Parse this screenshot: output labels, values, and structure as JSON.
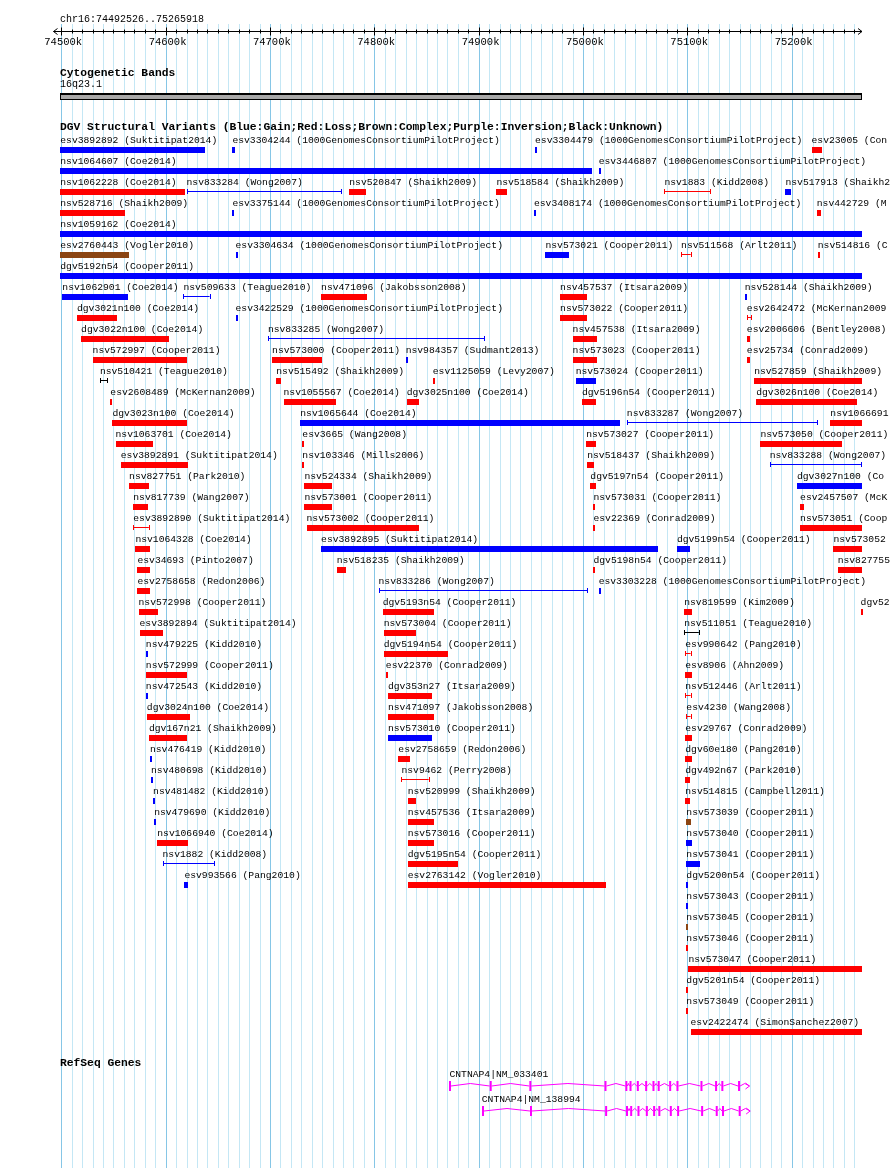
{
  "ruler": {
    "title": "chr16:74492526..75265918",
    "ticks": [
      "74500k",
      "74600k",
      "74700k",
      "74800k",
      "74900k",
      "75000k",
      "75100k",
      "75200k"
    ]
  },
  "cytogenetic_bands": {
    "title": "Cytogenetic Bands",
    "bands": [
      {
        "label": "16q23.1"
      }
    ]
  },
  "dgv": {
    "title": "DGV Structural Variants (Blue:Gain;Red:Loss;Brown:Complex;Purple:Inversion;Black:Unknown)",
    "rows": [
      {
        "features": [
          {
            "label": "esv3892892 (Suktitipat2014)",
            "kind": "bar",
            "color": "#0000ff"
          },
          {
            "label": "esv3304244 (1000GenomesConsortiumPilotProject)",
            "kind": "bar",
            "color": "#0000ff"
          },
          {
            "label": "esv3304479 (1000GenomesConsortiumPilotProject)",
            "kind": "bar",
            "color": "#0000ff"
          },
          {
            "label": "esv23005 (Con",
            "kind": "bar",
            "color": "#ff0000"
          }
        ]
      },
      {
        "features": [
          {
            "label": "nsv1064607 (Coe2014)",
            "kind": "bar",
            "color": "#0000ff"
          },
          {
            "label": "esv3446807 (1000GenomesConsortiumPilotProject)",
            "kind": "bar",
            "color": "#0000ff"
          }
        ]
      },
      {
        "features": [
          {
            "label": "nsv1062228 (Coe2014)",
            "kind": "bar",
            "color": "#ff0000"
          },
          {
            "label": "nsv833284 (Wong2007)",
            "kind": "span",
            "color": "#0000ff"
          },
          {
            "label": "nsv520847 (Shaikh2009)",
            "kind": "bar",
            "color": "#ff0000"
          },
          {
            "label": "nsv518584 (Shaikh2009)",
            "kind": "bar",
            "color": "#ff0000"
          },
          {
            "label": "nsv1883 (Kidd2008)",
            "kind": "span",
            "color": "#ff0000"
          },
          {
            "label": "nsv517913 (Shaikh2",
            "kind": "bar",
            "color": "#0000ff"
          }
        ]
      },
      {
        "features": [
          {
            "label": "nsv528716 (Shaikh2009)",
            "kind": "bar",
            "color": "#ff0000"
          },
          {
            "label": "esv3375144 (1000GenomesConsortiumPilotProject)",
            "kind": "bar",
            "color": "#0000ff"
          },
          {
            "label": "esv3408174 (1000GenomesConsortiumPilotProject)",
            "kind": "bar",
            "color": "#0000ff"
          },
          {
            "label": "nsv442729 (M",
            "kind": "bar",
            "color": "#ff0000"
          }
        ]
      },
      {
        "features": [
          {
            "label": "nsv1059162 (Coe2014)",
            "kind": "bar",
            "color": "#0000ff"
          }
        ]
      },
      {
        "features": [
          {
            "label": "esv2760443 (Vogler2010)",
            "kind": "bar",
            "color": "#8b4513"
          },
          {
            "label": "esv3304634 (1000GenomesConsortiumPilotProject)",
            "kind": "bar",
            "color": "#0000ff"
          },
          {
            "label": "nsv573021 (Cooper2011)",
            "kind": "bar",
            "color": "#0000ff"
          },
          {
            "label": "nsv511568 (Arlt2011)",
            "kind": "span",
            "color": "#ff0000"
          },
          {
            "label": "nsv514816 (C",
            "kind": "bar",
            "color": "#ff0000"
          }
        ]
      },
      {
        "features": [
          {
            "label": "dgv5192n54 (Cooper2011)",
            "kind": "bar",
            "color": "#0000ff"
          }
        ]
      },
      {
        "features": [
          {
            "label": "nsv1062901 (Coe2014)",
            "kind": "bar",
            "color": "#0000ff"
          },
          {
            "label": "nsv509633 (Teague2010)",
            "kind": "span",
            "color": "#0000ff"
          },
          {
            "label": "nsv471096 (Jakobsson2008)",
            "kind": "bar",
            "color": "#ff0000"
          },
          {
            "label": "nsv457537 (Itsara2009)",
            "kind": "bar",
            "color": "#ff0000"
          },
          {
            "label": "nsv528144 (Shaikh2009)",
            "kind": "bar",
            "color": "#0000ff"
          }
        ]
      },
      {
        "features": [
          {
            "label": "dgv3021n100 (Coe2014)",
            "kind": "bar",
            "color": "#ff0000"
          },
          {
            "label": "esv3422529 (1000GenomesConsortiumPilotProject)",
            "kind": "bar",
            "color": "#0000ff"
          },
          {
            "label": "nsv573022 (Cooper2011)",
            "kind": "bar",
            "color": "#ff0000"
          },
          {
            "label": "esv2642472 (McKernan2009",
            "kind": "span",
            "color": "#ff0000"
          }
        ]
      },
      {
        "features": [
          {
            "label": "dgv3022n100 (Coe2014)",
            "kind": "bar",
            "color": "#ff0000"
          },
          {
            "label": "nsv833285 (Wong2007)",
            "kind": "span",
            "color": "#0000ff"
          },
          {
            "label": "nsv457538 (Itsara2009)",
            "kind": "bar",
            "color": "#ff0000"
          },
          {
            "label": "esv2006606 (Bentley2008)",
            "kind": "bar",
            "color": "#ff0000"
          }
        ]
      },
      {
        "features": [
          {
            "label": "nsv572997 (Cooper2011)",
            "kind": "bar",
            "color": "#ff0000"
          },
          {
            "label": "nsv573000 (Cooper2011)",
            "kind": "bar",
            "color": "#ff0000"
          },
          {
            "label": "nsv984357 (Sudmant2013)",
            "kind": "bar",
            "color": "#0000ff"
          },
          {
            "label": "nsv573023 (Cooper2011)",
            "kind": "bar",
            "color": "#ff0000"
          },
          {
            "label": "esv25734 (Conrad2009)",
            "kind": "bar",
            "color": "#ff0000"
          }
        ]
      },
      {
        "features": [
          {
            "label": "nsv510421 (Teague2010)",
            "kind": "span",
            "color": "#000000"
          },
          {
            "label": "nsv515492 (Shaikh2009)",
            "kind": "bar",
            "color": "#ff0000"
          },
          {
            "label": "esv1125059 (Levy2007)",
            "kind": "bar",
            "color": "#ff0000"
          },
          {
            "label": "nsv573024 (Cooper2011)",
            "kind": "bar",
            "color": "#0000ff"
          },
          {
            "label": "nsv527859 (Shaikh2009)",
            "kind": "bar",
            "color": "#ff0000"
          }
        ]
      },
      {
        "features": [
          {
            "label": "esv2608489 (McKernan2009)",
            "kind": "bar",
            "color": "#ff0000"
          },
          {
            "label": "nsv1055567 (Coe2014)",
            "kind": "bar",
            "color": "#ff0000"
          },
          {
            "label": "dgv3025n100 (Coe2014)",
            "kind": "bar",
            "color": "#ff0000"
          },
          {
            "label": "dgv5196n54 (Cooper2011)",
            "kind": "bar",
            "color": "#ff0000"
          },
          {
            "label": "dgv3026n100 (Coe2014)",
            "kind": "bar",
            "color": "#ff0000"
          }
        ]
      },
      {
        "features": [
          {
            "label": "dgv3023n100 (Coe2014)",
            "kind": "bar",
            "color": "#ff0000"
          },
          {
            "label": "nsv1065644 (Coe2014)",
            "kind": "bar",
            "color": "#0000ff"
          },
          {
            "label": "nsv833287 (Wong2007)",
            "kind": "span",
            "color": "#0000ff"
          },
          {
            "label": "nsv1066691",
            "kind": "bar",
            "color": "#ff0000"
          }
        ]
      },
      {
        "features": [
          {
            "label": "nsv1063701 (Coe2014)",
            "kind": "bar",
            "color": "#ff0000"
          },
          {
            "label": "esv3665 (Wang2008)",
            "kind": "bar",
            "color": "#ff0000"
          },
          {
            "label": "nsv573027 (Cooper2011)",
            "kind": "bar",
            "color": "#ff0000"
          },
          {
            "label": "nsv573050 (Cooper2011)",
            "kind": "bar",
            "color": "#ff0000"
          }
        ]
      },
      {
        "features": [
          {
            "label": "esv3892891 (Suktitipat2014)",
            "kind": "bar",
            "color": "#ff0000"
          },
          {
            "label": "nsv103346 (Mills2006)",
            "kind": "bar",
            "color": "#ff0000"
          },
          {
            "label": "nsv518437 (Shaikh2009)",
            "kind": "bar",
            "color": "#ff0000"
          },
          {
            "label": "nsv833288 (Wong2007)",
            "kind": "span",
            "color": "#0000ff"
          }
        ]
      },
      {
        "features": [
          {
            "label": "nsv827751 (Park2010)",
            "kind": "bar",
            "color": "#ff0000"
          },
          {
            "label": "nsv524334 (Shaikh2009)",
            "kind": "bar",
            "color": "#ff0000"
          },
          {
            "label": "dgv5197n54 (Cooper2011)",
            "kind": "bar",
            "color": "#ff0000"
          },
          {
            "label": "dgv3027n100 (Co",
            "kind": "bar",
            "color": "#0000ff"
          }
        ]
      },
      {
        "features": [
          {
            "label": "nsv817739 (Wang2007)",
            "kind": "bar",
            "color": "#ff0000"
          },
          {
            "label": "nsv573001 (Cooper2011)",
            "kind": "bar",
            "color": "#ff0000"
          },
          {
            "label": "nsv573031 (Cooper2011)",
            "kind": "bar",
            "color": "#ff0000"
          },
          {
            "label": "esv2457507 (McK",
            "kind": "bar",
            "color": "#ff0000"
          }
        ]
      },
      {
        "features": [
          {
            "label": "esv3892890 (Suktitipat2014)",
            "kind": "span",
            "color": "#ff0000"
          },
          {
            "label": "nsv573002 (Cooper2011)",
            "kind": "bar",
            "color": "#ff0000"
          },
          {
            "label": "esv22369 (Conrad2009)",
            "kind": "bar",
            "color": "#ff0000"
          },
          {
            "label": "nsv573051 (Coop",
            "kind": "bar",
            "color": "#ff0000"
          }
        ]
      },
      {
        "features": [
          {
            "label": "nsv1064328 (Coe2014)",
            "kind": "bar",
            "color": "#ff0000"
          },
          {
            "label": "esv3892895 (Suktitipat2014)",
            "kind": "bar",
            "color": "#0000ff"
          },
          {
            "label": "dgv5199n54 (Cooper2011)",
            "kind": "bar",
            "color": "#0000ff"
          },
          {
            "label": "nsv573052",
            "kind": "bar",
            "color": "#ff0000"
          }
        ]
      },
      {
        "features": [
          {
            "label": "esv34693 (Pinto2007)",
            "kind": "bar",
            "color": "#ff0000"
          },
          {
            "label": "nsv518235 (Shaikh2009)",
            "kind": "bar",
            "color": "#ff0000"
          },
          {
            "label": "dgv5198n54 (Cooper2011)",
            "kind": "bar",
            "color": "#ff0000"
          },
          {
            "label": "nsv827755",
            "kind": "bar",
            "color": "#ff0000"
          }
        ]
      },
      {
        "features": [
          {
            "label": "esv2758658 (Redon2006)",
            "kind": "bar",
            "color": "#ff0000"
          },
          {
            "label": "nsv833286 (Wong2007)",
            "kind": "span",
            "color": "#0000ff"
          },
          {
            "label": "esv3303228 (1000GenomesConsortiumPilotProject)",
            "kind": "bar",
            "color": "#0000ff"
          }
        ]
      },
      {
        "features": [
          {
            "label": "nsv572998 (Cooper2011)",
            "kind": "bar",
            "color": "#ff0000"
          },
          {
            "label": "dgv5193n54 (Cooper2011)",
            "kind": "bar",
            "color": "#ff0000"
          },
          {
            "label": "nsv819599 (Kim2009)",
            "kind": "bar",
            "color": "#ff0000"
          },
          {
            "label": "dgv52",
            "kind": "bar",
            "color": "#ff0000"
          }
        ]
      },
      {
        "features": [
          {
            "label": "esv3892894 (Suktitipat2014)",
            "kind": "bar",
            "color": "#ff0000"
          },
          {
            "label": "nsv573004 (Cooper2011)",
            "kind": "bar",
            "color": "#ff0000"
          },
          {
            "label": "nsv511051 (Teague2010)",
            "kind": "span",
            "color": "#000000"
          }
        ]
      },
      {
        "features": [
          {
            "label": "nsv479225 (Kidd2010)",
            "kind": "bar",
            "color": "#0000ff"
          },
          {
            "label": "dgv5194n54 (Cooper2011)",
            "kind": "bar",
            "color": "#ff0000"
          },
          {
            "label": "esv990642 (Pang2010)",
            "kind": "span",
            "color": "#ff0000"
          }
        ]
      },
      {
        "features": [
          {
            "label": "nsv572999 (Cooper2011)",
            "kind": "bar",
            "color": "#ff0000"
          },
          {
            "label": "esv22370 (Conrad2009)",
            "kind": "bar",
            "color": "#ff0000"
          },
          {
            "label": "esv8906 (Ahn2009)",
            "kind": "bar",
            "color": "#ff0000"
          }
        ]
      },
      {
        "features": [
          {
            "label": "nsv472543 (Kidd2010)",
            "kind": "bar",
            "color": "#0000ff"
          },
          {
            "label": "dgv353n27 (Itsara2009)",
            "kind": "bar",
            "color": "#ff0000"
          },
          {
            "label": "nsv512446 (Arlt2011)",
            "kind": "span",
            "color": "#ff0000"
          }
        ]
      },
      {
        "features": [
          {
            "label": "dgv3024n100 (Coe2014)",
            "kind": "bar",
            "color": "#ff0000"
          },
          {
            "label": "nsv471097 (Jakobsson2008)",
            "kind": "bar",
            "color": "#ff0000"
          },
          {
            "label": "esv4230 (Wang2008)",
            "kind": "span",
            "color": "#ff0000"
          }
        ]
      },
      {
        "features": [
          {
            "label": "dgv167n21 (Shaikh2009)",
            "kind": "bar",
            "color": "#ff0000"
          },
          {
            "label": "nsv573010 (Cooper2011)",
            "kind": "bar",
            "color": "#0000ff"
          },
          {
            "label": "esv29767 (Conrad2009)",
            "kind": "bar",
            "color": "#ff0000"
          }
        ]
      },
      {
        "features": [
          {
            "label": "nsv476419 (Kidd2010)",
            "kind": "bar",
            "color": "#0000ff"
          },
          {
            "label": "esv2758659 (Redon2006)",
            "kind": "bar",
            "color": "#ff0000"
          },
          {
            "label": "dgv60e180 (Pang2010)",
            "kind": "bar",
            "color": "#ff0000"
          }
        ]
      },
      {
        "features": [
          {
            "label": "nsv480698 (Kidd2010)",
            "kind": "bar",
            "color": "#0000ff"
          },
          {
            "label": "nsv9462 (Perry2008)",
            "kind": "span",
            "color": "#ff0000"
          },
          {
            "label": "dgv492n67 (Park2010)",
            "kind": "bar",
            "color": "#ff0000"
          }
        ]
      },
      {
        "features": [
          {
            "label": "nsv481482 (Kidd2010)",
            "kind": "bar",
            "color": "#0000ff"
          },
          {
            "label": "nsv520999 (Shaikh2009)",
            "kind": "bar",
            "color": "#ff0000"
          },
          {
            "label": "nsv514815 (Campbell2011)",
            "kind": "bar",
            "color": "#ff0000"
          }
        ]
      },
      {
        "features": [
          {
            "label": "nsv479690 (Kidd2010)",
            "kind": "bar",
            "color": "#0000ff"
          },
          {
            "label": "nsv457536 (Itsara2009)",
            "kind": "bar",
            "color": "#ff0000"
          },
          {
            "label": "nsv573039 (Cooper2011)",
            "kind": "bar",
            "color": "#8b4513"
          }
        ]
      },
      {
        "features": [
          {
            "label": "nsv1066940 (Coe2014)",
            "kind": "bar",
            "color": "#ff0000"
          },
          {
            "label": "nsv573016 (Cooper2011)",
            "kind": "bar",
            "color": "#ff0000"
          },
          {
            "label": "nsv573040 (Cooper2011)",
            "kind": "bar",
            "color": "#0000ff"
          }
        ]
      },
      {
        "features": [
          {
            "label": "nsv1882 (Kidd2008)",
            "kind": "span",
            "color": "#0000ff"
          },
          {
            "label": "dgv5195n54 (Cooper2011)",
            "kind": "bar",
            "color": "#ff0000"
          },
          {
            "label": "nsv573041 (Cooper2011)",
            "kind": "bar",
            "color": "#0000ff"
          }
        ]
      },
      {
        "features": [
          {
            "label": "esv993566 (Pang2010)",
            "kind": "bar",
            "color": "#0000ff"
          },
          {
            "label": "esv2763142 (Vogler2010)",
            "kind": "bar",
            "color": "#ff0000"
          },
          {
            "label": "dgv5200n54 (Cooper2011)",
            "kind": "bar",
            "color": "#0000ff"
          }
        ]
      },
      {
        "features": [
          {
            "label": "nsv573043 (Cooper2011)",
            "kind": "bar",
            "color": "#0000ff"
          }
        ]
      },
      {
        "features": [
          {
            "label": "nsv573045 (Cooper2011)",
            "kind": "bar",
            "color": "#8b4513"
          }
        ]
      },
      {
        "features": [
          {
            "label": "nsv573046 (Cooper2011)",
            "kind": "bar",
            "color": "#ff0000"
          }
        ]
      },
      {
        "features": [
          {
            "label": "nsv573047 (Cooper2011)",
            "kind": "bar",
            "color": "#ff0000"
          }
        ]
      },
      {
        "features": [
          {
            "label": "dgv5201n54 (Cooper2011)",
            "kind": "bar",
            "color": "#ff0000"
          }
        ]
      },
      {
        "features": [
          {
            "label": "nsv573049 (Cooper2011)",
            "kind": "bar",
            "color": "#ff0000"
          }
        ]
      },
      {
        "features": [
          {
            "label": "esv2422474 (SimonSanchez2007)",
            "kind": "bar",
            "color": "#ff0000"
          }
        ]
      }
    ]
  },
  "refseq": {
    "title": "RefSeq Genes",
    "genes": [
      {
        "label": "CNTNAP4|NM_033401",
        "kind": "forward"
      },
      {
        "label": "CNTNAP4|NM_138994",
        "kind": "forward"
      }
    ]
  }
}
